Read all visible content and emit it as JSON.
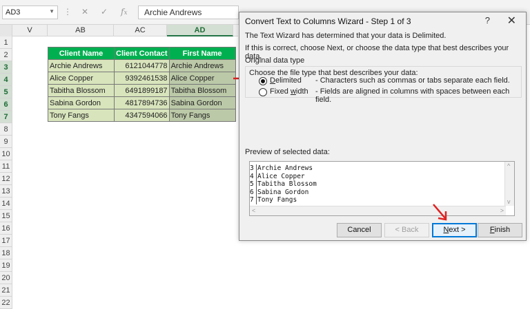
{
  "formula_bar": {
    "name_box": "AD3",
    "formula": "Archie Andrews"
  },
  "grid": {
    "columns": [
      "V",
      "AB",
      "AC",
      "AD"
    ],
    "rows": [
      "1",
      "2",
      "3",
      "4",
      "5",
      "6",
      "7",
      "8",
      "9",
      "10",
      "11",
      "12",
      "13",
      "14",
      "15",
      "16",
      "17",
      "18",
      "19",
      "20",
      "21",
      "22"
    ],
    "headers": [
      "Client Name",
      "Client Contact",
      "First Name"
    ],
    "data": [
      [
        "Archie Andrews",
        "6121044778",
        "Archie Andrews"
      ],
      [
        "Alice Copper",
        "9392461538",
        "Alice Copper"
      ],
      [
        "Tabitha Blossom",
        "6491899187",
        "Tabitha Blossom"
      ],
      [
        "Sabina Gordon",
        "4817894736",
        "Sabina Gordon"
      ],
      [
        "Tony Fangs",
        "4347594066",
        "Tony Fangs"
      ]
    ]
  },
  "dialog": {
    "title": "Convert Text to Columns Wizard - Step 1 of 3",
    "help": "?",
    "close": "✕",
    "intro1": "The Text Wizard has determined that your data is Delimited.",
    "intro2": "If this is correct, choose Next, or choose the data type that best describes your data.",
    "group_title": "Original data type",
    "choose_label": "Choose the file type that best describes your data:",
    "options": [
      {
        "label": "Delimited",
        "desc": "- Characters such as commas or tabs separate each field.",
        "checked": true
      },
      {
        "label": "Fixed width",
        "desc": "- Fields are aligned in columns with spaces between each field.",
        "checked": false
      }
    ],
    "preview_label": "Preview of selected data:",
    "preview_lines": [
      {
        "num": "3",
        "text": "Archie Andrews"
      },
      {
        "num": "4",
        "text": "Alice Copper"
      },
      {
        "num": "5",
        "text": "Tabitha Blossom"
      },
      {
        "num": "6",
        "text": "Sabina Gordon"
      },
      {
        "num": "7",
        "text": "Tony Fangs"
      }
    ],
    "buttons": {
      "cancel": "Cancel",
      "back": "< Back",
      "next": "Next >",
      "finish": "Finish"
    }
  },
  "colors": {
    "header_green": "#00b050",
    "cell_green": "#d8e4bc",
    "annotation_red": "#e02020",
    "accent_blue": "#0078d7"
  }
}
